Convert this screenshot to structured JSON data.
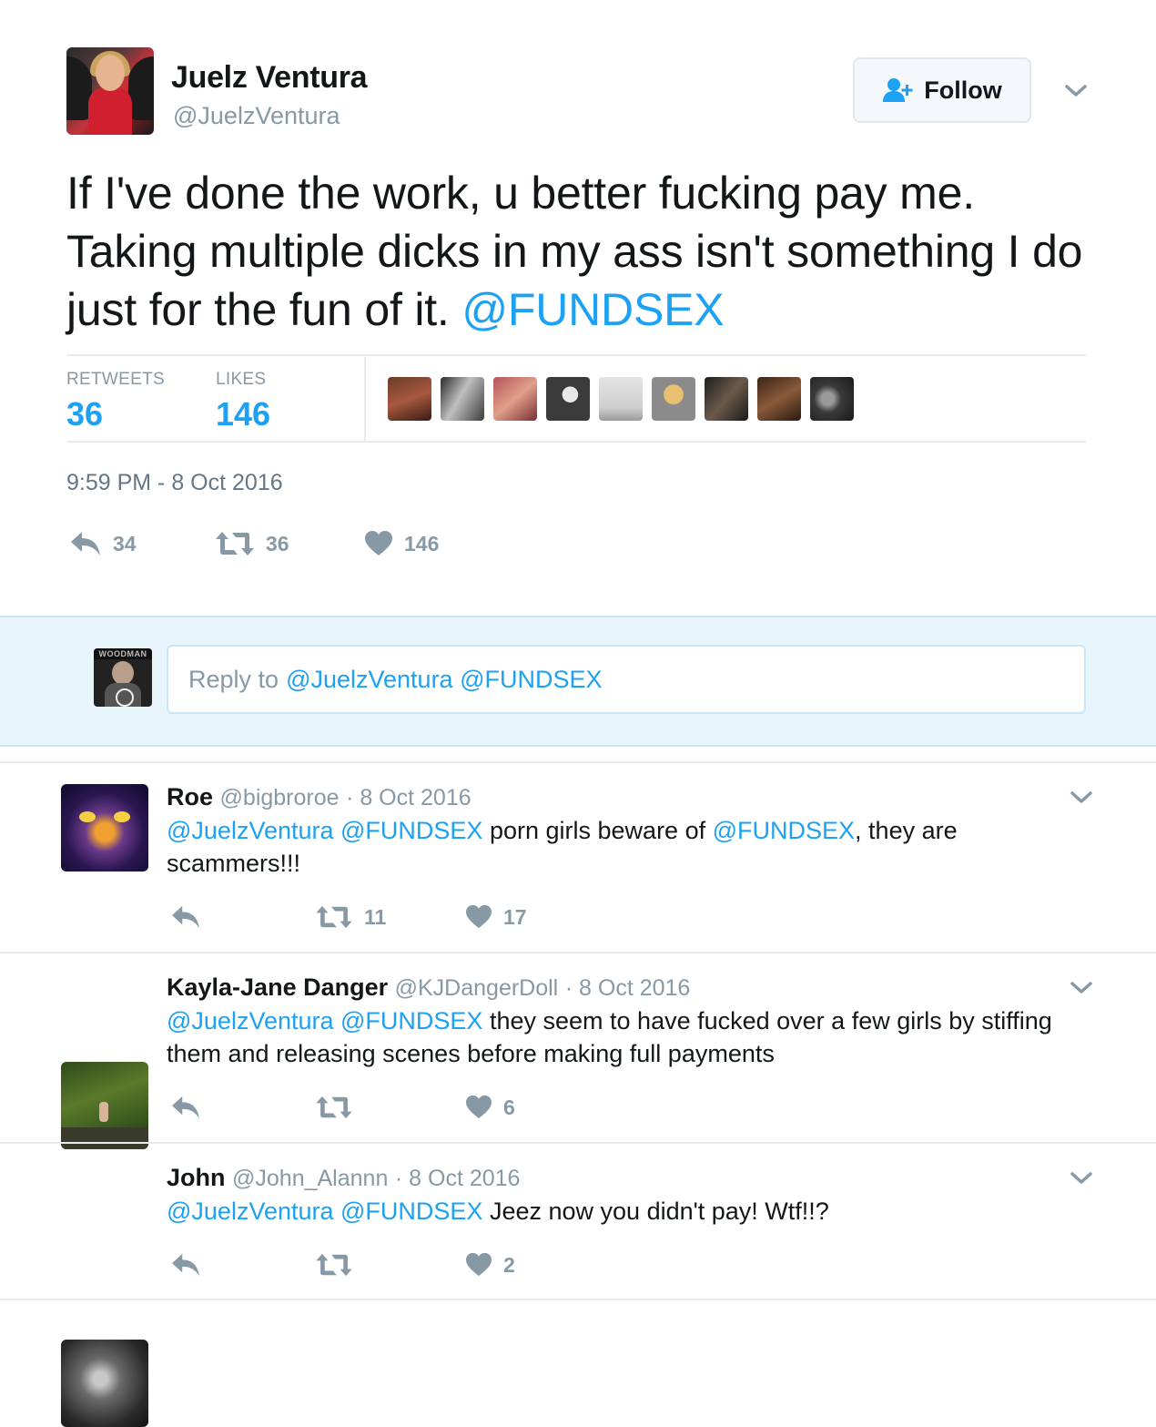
{
  "tweet": {
    "author_name": "Juelz Ventura",
    "author_handle": "@JuelzVentura",
    "follow_label": "Follow",
    "text_plain": "If I've done the work, u better fucking pay me. Taking multiple dicks in my ass isn't something I do just for the fun of it.",
    "text_mention": "@FUNDSEX",
    "stats": {
      "retweets_label": "RETWEETS",
      "retweets_count": "36",
      "likes_label": "LIKES",
      "likes_count": "146"
    },
    "timestamp": "9:59 PM - 8 Oct 2016",
    "actions": {
      "reply_count": "34",
      "retweet_count": "36",
      "like_count": "146"
    }
  },
  "reply_box": {
    "placeholder_prefix": "Reply to",
    "placeholder_mentions": "@JuelzVentura @FUNDSEX",
    "avatar_text": "WOODMAN"
  },
  "replies": [
    {
      "name": "Roe",
      "handle": "@bigbroroe",
      "date": "· 8 Oct 2016",
      "mentions": "@JuelzVentura @FUNDSEX",
      "text_a": "porn girls beware of",
      "mention_b": "@FUNDSEX",
      "text_b": ", they are scammers!!!",
      "retweets": "11",
      "likes": "17"
    },
    {
      "name": "Kayla-Jane Danger",
      "handle": "@KJDangerDoll",
      "date": "· 8 Oct 2016",
      "mentions": "@JuelzVentura @FUNDSEX",
      "text_a": "they seem to have fucked over a few girls by stiffing them and releasing scenes before making full payments",
      "retweets": "",
      "likes": "6"
    },
    {
      "name": "John",
      "handle": "@John_Alannn",
      "date": "· 8 Oct 2016",
      "mentions": "@JuelzVentura @FUNDSEX",
      "text_a": "Jeez now you didn't pay! Wtf!!?",
      "retweets": "",
      "likes": "2"
    }
  ],
  "colors": {
    "link": "#1da1f2",
    "muted": "#8899a6",
    "reply_bg": "#e8f5fd"
  }
}
